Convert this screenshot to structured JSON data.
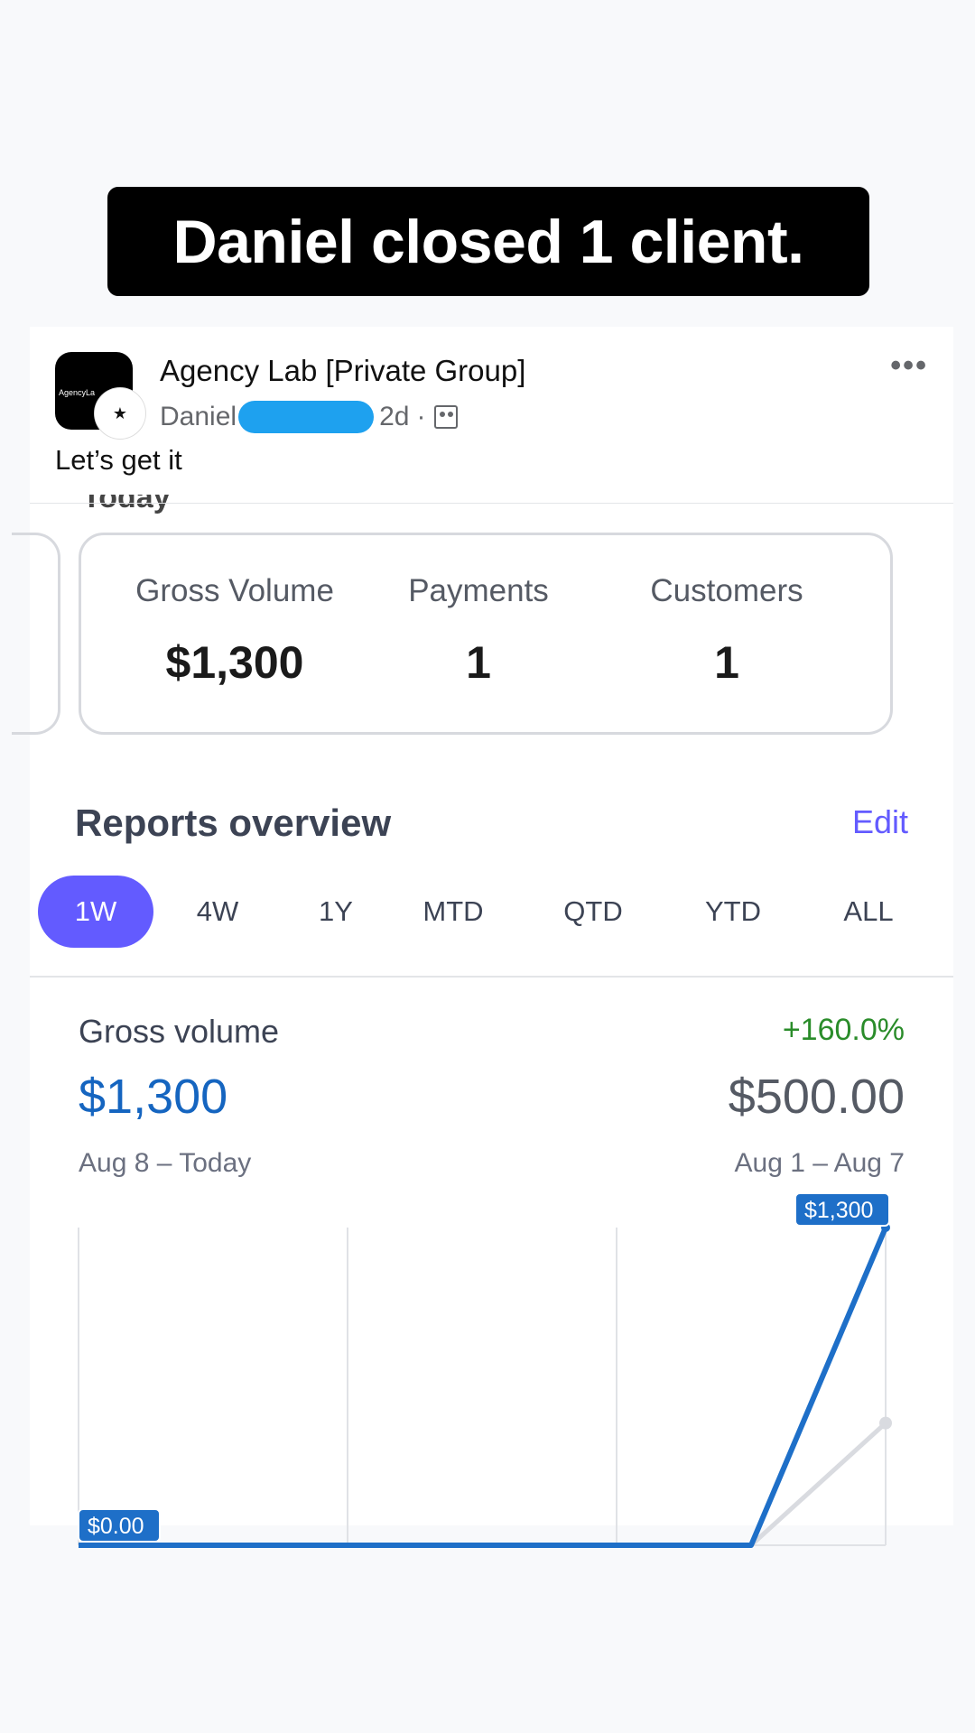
{
  "caption": "Daniel closed 1 client.",
  "post": {
    "group_name": "Agency Lab [Private Group]",
    "group_logo_text": "AgencyLa",
    "author": "Daniel",
    "time": "2d",
    "separator": "·",
    "text": "Let’s get it",
    "cut_heading": "Today"
  },
  "stats": {
    "gross_volume_label": "Gross Volume",
    "gross_volume_value": "$1,300",
    "payments_label": "Payments",
    "payments_value": "1",
    "customers_label": "Customers",
    "customers_value": "1"
  },
  "reports": {
    "title": "Reports overview",
    "edit_label": "Edit",
    "tabs": [
      "1W",
      "4W",
      "1Y",
      "MTD",
      "QTD",
      "YTD",
      "ALL"
    ],
    "active_tab": "1W"
  },
  "gross_volume": {
    "label": "Gross volume",
    "change": "+160.0%",
    "current_value": "$1,300",
    "previous_value": "$500.00",
    "current_period": "Aug 8 – Today",
    "previous_period": "Aug 1 – Aug 7"
  },
  "colors": {
    "accent": "#635bff",
    "current_series": "#1e6fc8",
    "previous_series": "#d9dbe0",
    "positive": "#2a8c2a",
    "redaction": "#1ea1ef"
  },
  "icons": [
    "more-icon",
    "audience-icon"
  ],
  "chart_data": {
    "type": "line",
    "x": [
      1,
      2,
      3,
      4,
      5,
      6,
      7
    ],
    "series": [
      {
        "values": [
          0,
          0,
          0,
          0,
          0,
          0,
          1300
        ]
      },
      {
        "values": [
          0,
          0,
          0,
          0,
          0,
          0,
          500
        ]
      }
    ],
    "ylim": [
      0,
      1300
    ],
    "start_label": "$0.00",
    "end_label": "$1,300",
    "grid": true
  }
}
